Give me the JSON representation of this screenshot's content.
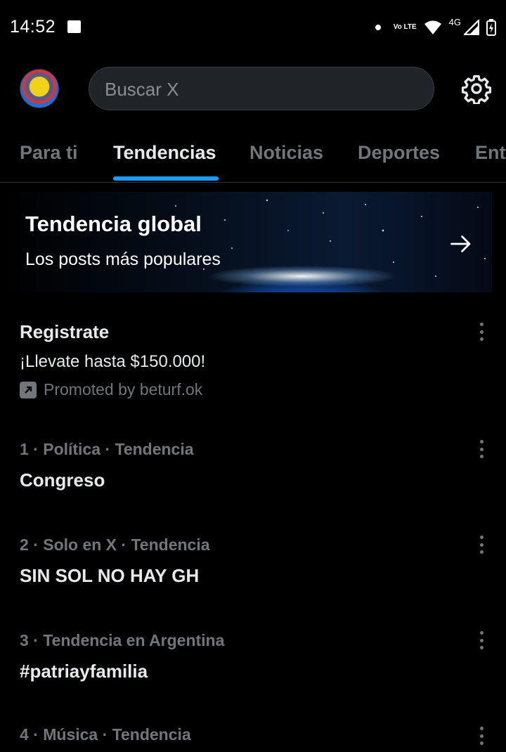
{
  "status_bar": {
    "time": "14:52",
    "volte": "Vo LTE",
    "network": "4G"
  },
  "header": {
    "search_placeholder": "Buscar X"
  },
  "tabs": [
    {
      "label": "Para ti"
    },
    {
      "label": "Tendencias"
    },
    {
      "label": "Noticias"
    },
    {
      "label": "Deportes"
    },
    {
      "label": "Ent"
    }
  ],
  "active_tab": "Tendencias",
  "banner": {
    "title": "Tendencia global",
    "subtitle": "Los posts más populares"
  },
  "promoted": {
    "title": "Registrate",
    "subtitle": "¡Llevate hasta $150.000!",
    "by": "Promoted by beturf.ok"
  },
  "trends": [
    {
      "meta": "1 · Política · Tendencia",
      "name": "Congreso"
    },
    {
      "meta": "2 · Solo en X · Tendencia",
      "name": "SIN SOL NO HAY GH"
    },
    {
      "meta": "3 · Tendencia en Argentina",
      "name": "#patriayfamilia"
    },
    {
      "meta": "4 · Música · Tendencia",
      "name": ""
    }
  ],
  "colors": {
    "background": "#000000",
    "accent": "#1d9bf0",
    "muted_text": "#71767b",
    "primary_text": "#e7e9ea"
  }
}
